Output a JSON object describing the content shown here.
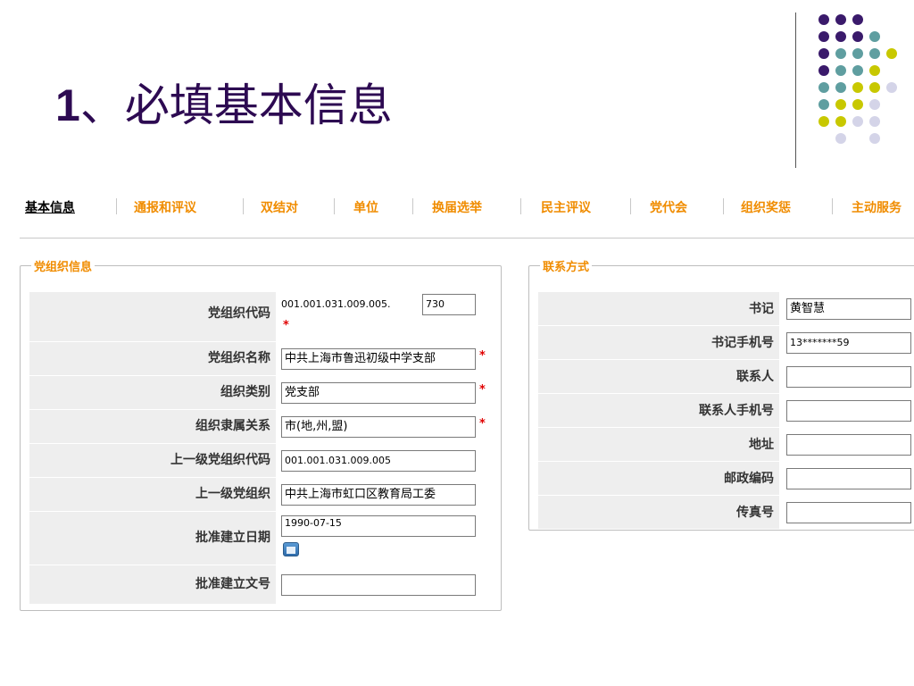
{
  "title": {
    "num": "1",
    "sep": "、",
    "text": "必填基本信息"
  },
  "decor": {
    "colors": {
      "purple": "#3a1a6b",
      "teal": "#5f9ea0",
      "yellow": "#c8c800",
      "lavender": "#d4d4e8"
    }
  },
  "tabs": [
    {
      "label": "基本信息",
      "active": true
    },
    {
      "label": "通报和评议",
      "active": false
    },
    {
      "label": "双结对",
      "active": false
    },
    {
      "label": "单位",
      "active": false
    },
    {
      "label": "换届选举",
      "active": false
    },
    {
      "label": "民主评议",
      "active": false
    },
    {
      "label": "党代会",
      "active": false
    },
    {
      "label": "组织奖惩",
      "active": false
    },
    {
      "label": "主动服务",
      "active": false
    }
  ],
  "left_panel": {
    "legend": "党组织信息",
    "rows": [
      {
        "label": "党组织代码",
        "prefix": "001.001.031.009.005.",
        "value": "730",
        "required": true
      },
      {
        "label": "党组织名称",
        "value": "中共上海市鲁迅初级中学支部",
        "required": true
      },
      {
        "label": "组织类别",
        "value": "党支部",
        "required": true
      },
      {
        "label": "组织隶属关系",
        "value": "市(地,州,盟)",
        "required": true
      },
      {
        "label": "上一级党组织代码",
        "value": "001.001.031.009.005",
        "required": false
      },
      {
        "label": "上一级党组织",
        "value": "中共上海市虹口区教育局工委",
        "required": false
      },
      {
        "label": "批准建立日期",
        "value": "1990-07-15",
        "required": false,
        "icon": "calendar-icon"
      },
      {
        "label": "批准建立文号",
        "value": "",
        "required": false
      }
    ],
    "required_mark": "*"
  },
  "right_panel": {
    "legend": "联系方式",
    "rows": [
      {
        "label": "书记",
        "value": "黄智慧"
      },
      {
        "label": "书记手机号",
        "value": "13*******59"
      },
      {
        "label": "联系人",
        "value": ""
      },
      {
        "label": "联系人手机号",
        "value": ""
      },
      {
        "label": "地址",
        "value": ""
      },
      {
        "label": "邮政编码",
        "value": ""
      },
      {
        "label": "传真号",
        "value": ""
      }
    ]
  },
  "colors": {
    "tab_text": "#f08c00",
    "required": "#e00000",
    "label_bg": "#eeeeee",
    "title": "#2d0a52"
  }
}
